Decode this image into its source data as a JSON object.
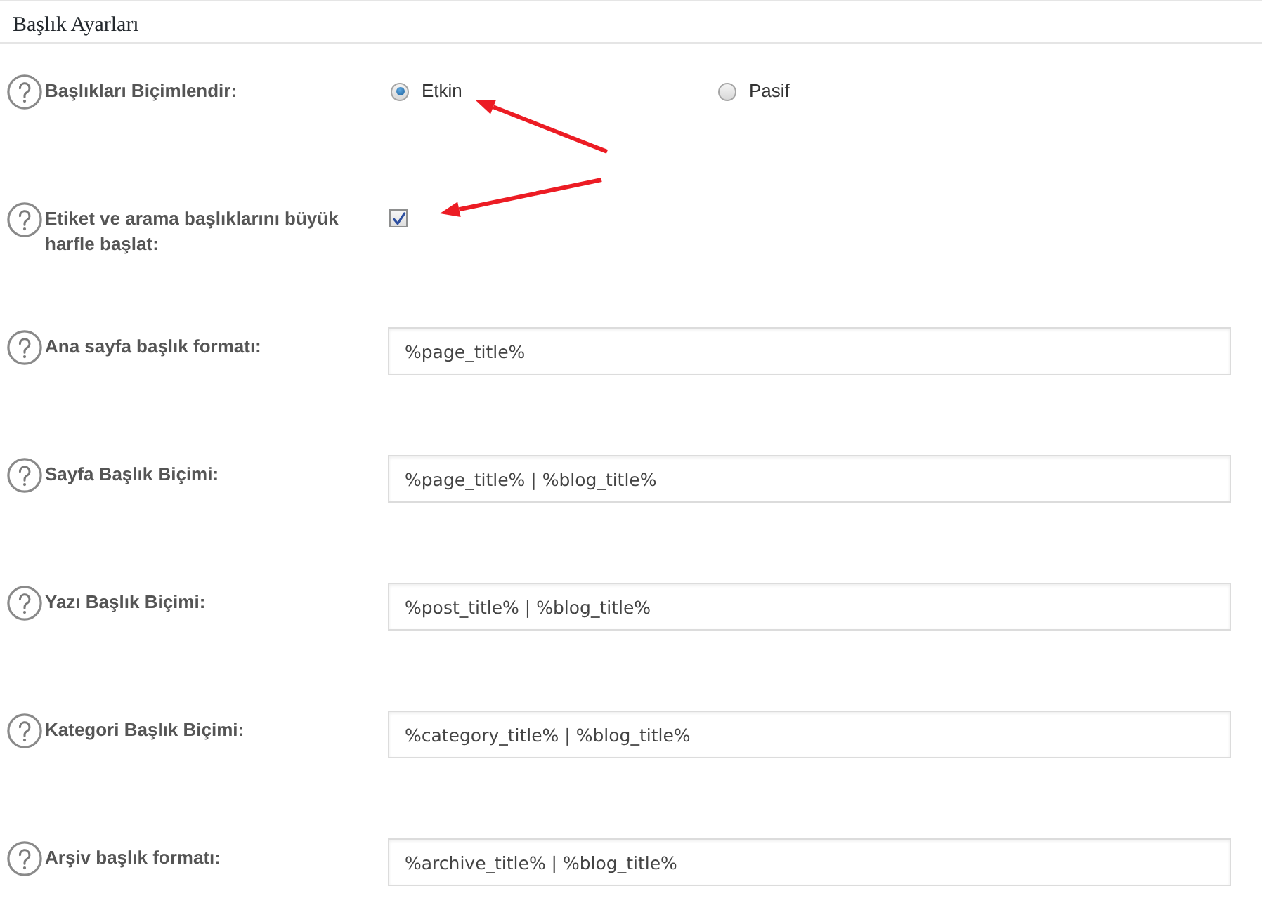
{
  "section": {
    "title": "Başlık Ayarları"
  },
  "settings": [
    {
      "kind": "radio",
      "label": "Başlıkları Biçimlendir:",
      "options": [
        {
          "label": "Etkin",
          "selected": true
        },
        {
          "label": "Pasif",
          "selected": false
        }
      ]
    },
    {
      "kind": "checkbox",
      "label": "Etiket ve arama başlıklarını büyük harfle başlat:",
      "checked": true
    },
    {
      "kind": "text",
      "label": "Ana sayfa başlık formatı:",
      "value": "%page_title%"
    },
    {
      "kind": "text",
      "label": "Sayfa Başlık Biçimi:",
      "value": "%page_title% | %blog_title%"
    },
    {
      "kind": "text",
      "label": "Yazı Başlık Biçimi:",
      "value": "%post_title% | %blog_title%"
    },
    {
      "kind": "text",
      "label": "Kategori Başlık Biçimi:",
      "value": "%category_title% | %blog_title%"
    },
    {
      "kind": "text",
      "label": "Arşiv başlık formatı:",
      "value": "%archive_title% | %blog_title%"
    }
  ]
}
